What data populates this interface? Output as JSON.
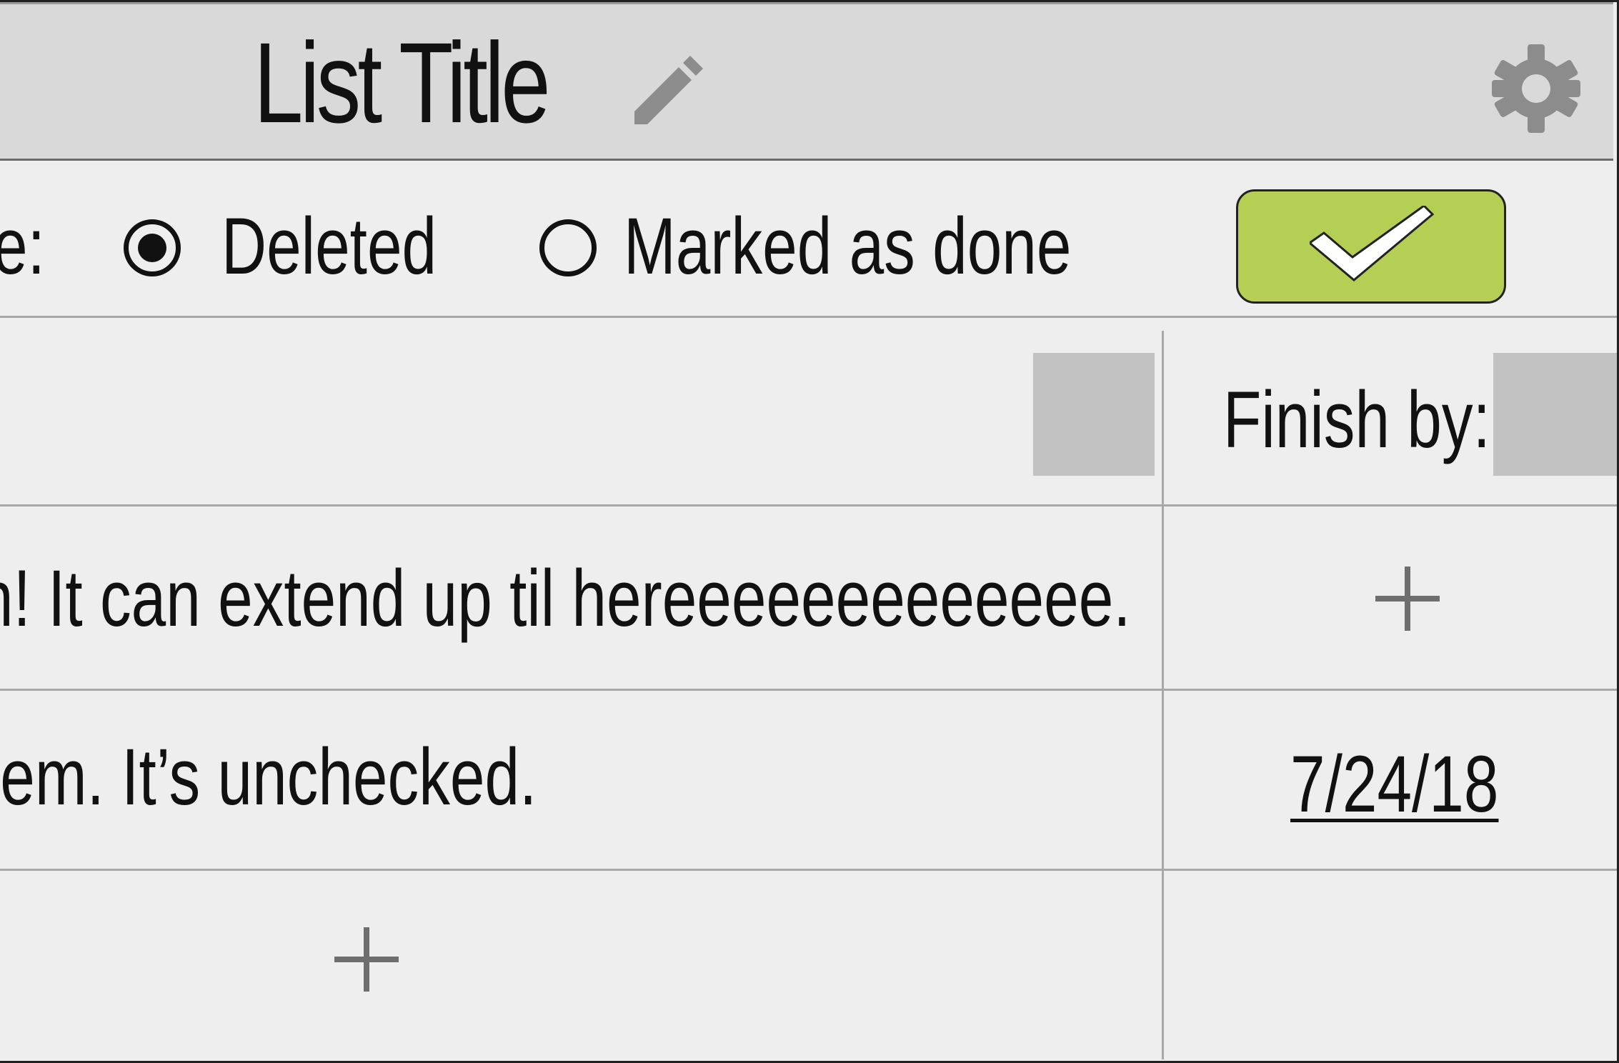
{
  "header": {
    "title": "List Title",
    "edit_icon": "pencil-icon",
    "settings_icon": "gear-icon"
  },
  "filter": {
    "label": "e:",
    "options": [
      {
        "label": "Deleted",
        "selected": true
      },
      {
        "label": "Marked as done",
        "selected": false
      }
    ],
    "confirm_icon": "checkmark-icon"
  },
  "table": {
    "finish_by_label": "Finish by:",
    "rows": [
      {
        "text": "n! It can extend up til hereeeeeeeeeeeee.",
        "date": "",
        "date_action": "+"
      },
      {
        "text": "tem. It’s unchecked.",
        "date": "7/24/18"
      }
    ],
    "add_row_label": "+"
  },
  "colors": {
    "header_bg": "#d9d9d9",
    "body_bg": "#eeeeee",
    "confirm_button": "#b5cf55",
    "checkbox_placeholder": "#c2c2c2",
    "icon_gray": "#8c8c8c"
  }
}
